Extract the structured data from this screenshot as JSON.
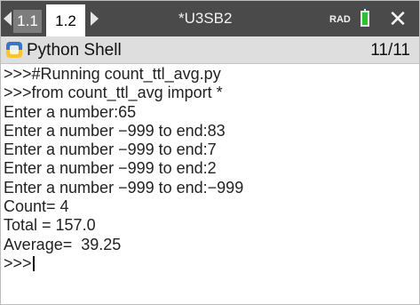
{
  "tabs": [
    {
      "label": "1.1"
    },
    {
      "label": "1.2"
    }
  ],
  "document_title": "*U3SB2",
  "angle_mode": "RAD",
  "shell": {
    "title": "Python Shell",
    "page_indicator": "11/11"
  },
  "console_lines": [
    ">>>#Running count_ttl_avg.py",
    ">>>from count_ttl_avg import *",
    "Enter a number:65",
    "Enter a number −999 to end:83",
    "Enter a number −999 to end:7",
    "Enter a number −999 to end:2",
    "Enter a number −999 to end:−999",
    "Count= 4",
    "Total = 157.0",
    "Average=  39.25"
  ],
  "prompt": ">>>",
  "colors": {
    "tabbar": "#4a4a4a",
    "battery": "#2ec22e",
    "python_blue": "#3b76c4",
    "python_yellow": "#f7c531"
  }
}
